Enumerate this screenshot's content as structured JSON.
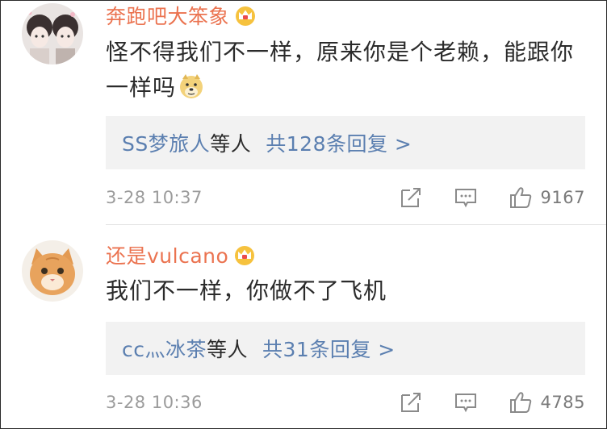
{
  "comments": [
    {
      "username": "奔跑吧大笨象",
      "text": "怪不得我们不一样，原来你是个老赖，能跟你一样吗",
      "emoji": "doge-emoji",
      "replies": {
        "users": "SS梦旅人",
        "suffix": "等人",
        "count_text": "共128条回复 >"
      },
      "timestamp": "3-28 10:37",
      "likes": "9167"
    },
    {
      "username": "还是vulcano",
      "text": "我们不一样，你做不了飞机",
      "replies": {
        "users": "cc灬冰茶",
        "suffix": "等人",
        "count_text": "共31条回复 >"
      },
      "timestamp": "3-28 10:36",
      "likes": "4785"
    }
  ],
  "colors": {
    "username": "#eb7350",
    "link": "#5b7fb0",
    "muted": "#9b9b9b",
    "reply_bg": "#f2f2f2"
  }
}
